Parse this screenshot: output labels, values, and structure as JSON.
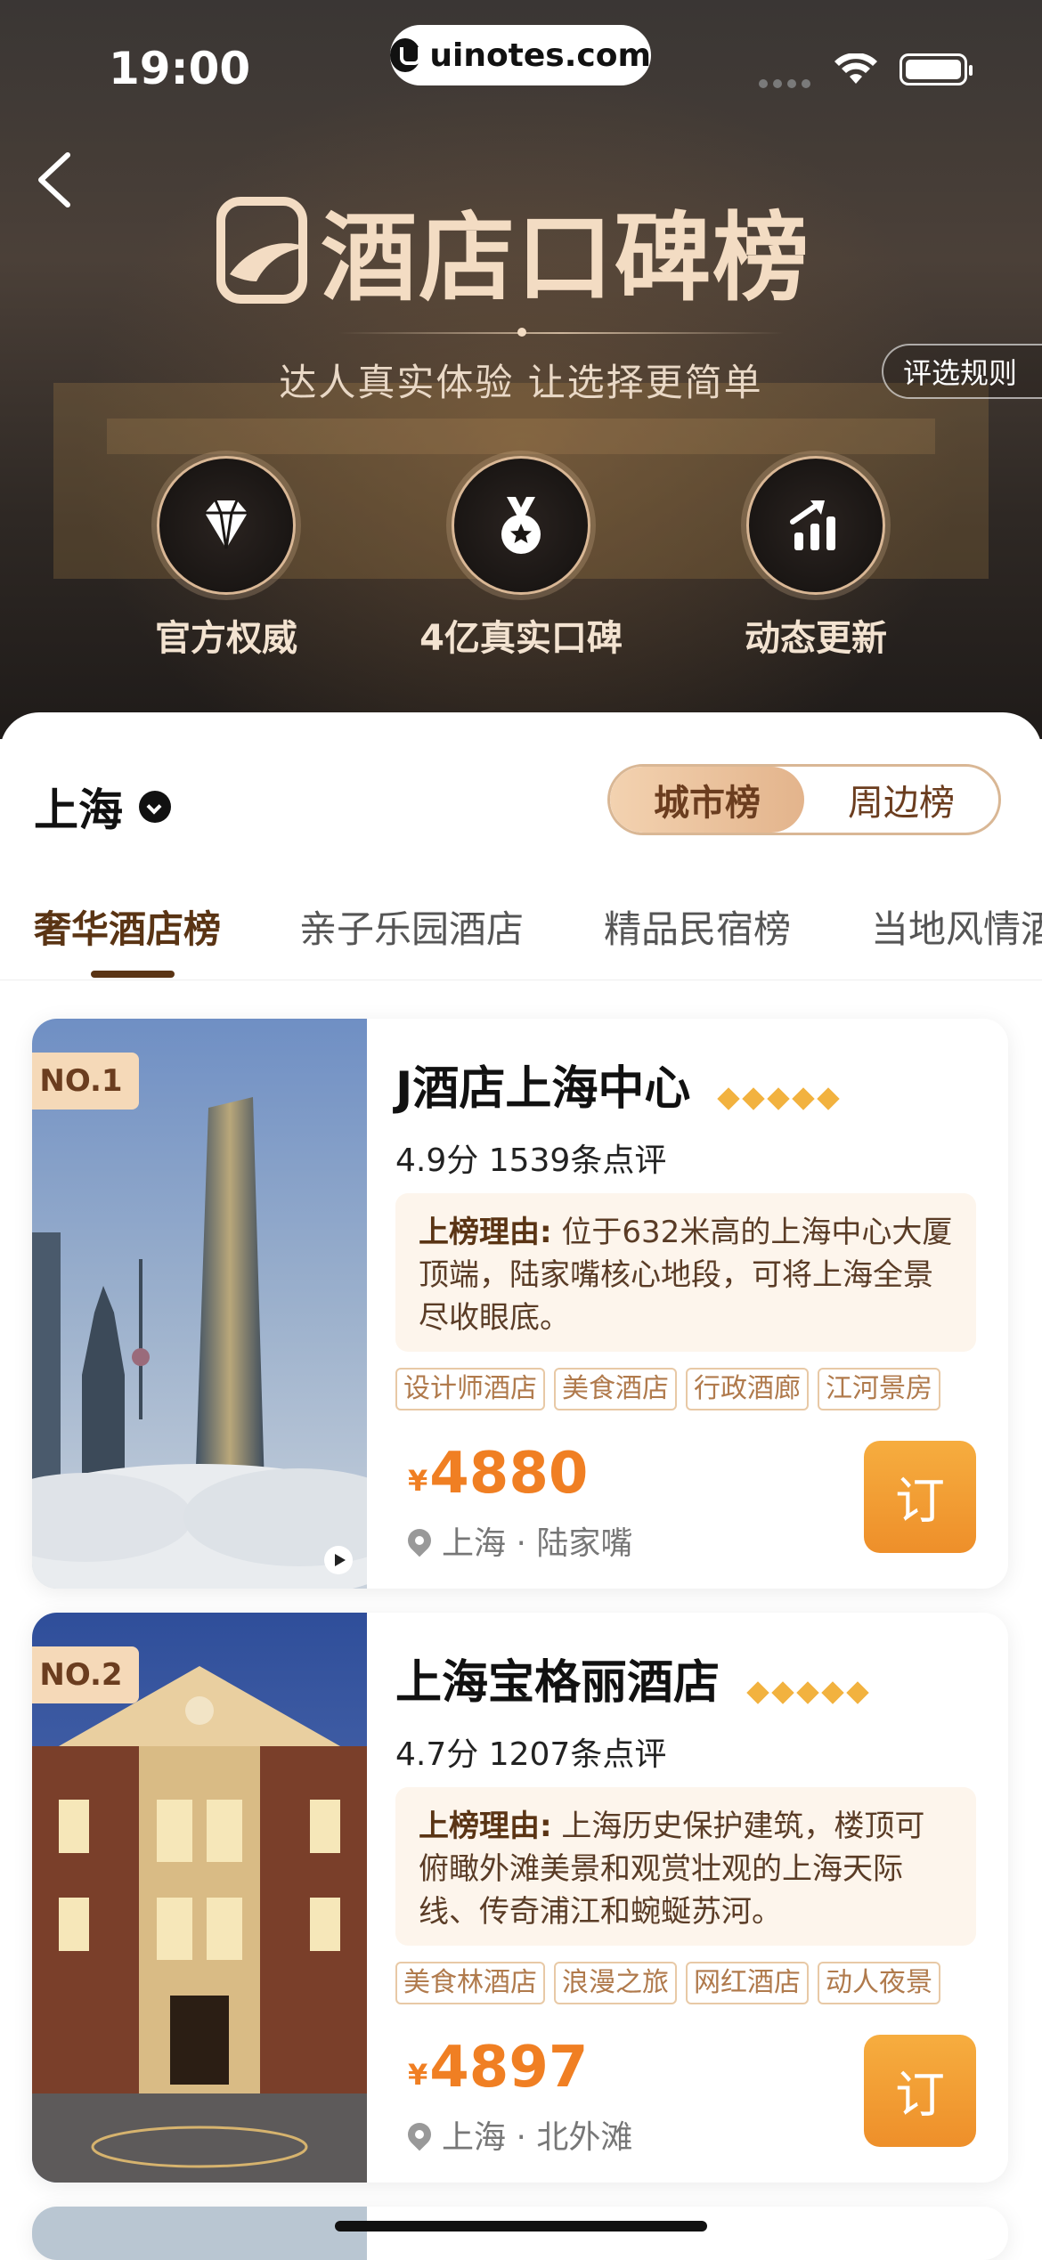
{
  "status_bar": {
    "time": "19:00",
    "url": "uinotes.com"
  },
  "header": {
    "title": "酒店口碑榜",
    "subtitle": "达人真实体验  让选择更简单",
    "rules_button": "评选规则",
    "badges": [
      {
        "label": "官方权威",
        "icon": "diamond-icon"
      },
      {
        "label": "4亿真实口碑",
        "icon": "medal-icon"
      },
      {
        "label": "动态更新",
        "icon": "rising-chart-icon"
      }
    ]
  },
  "city": {
    "name": "上海"
  },
  "scope_switch": {
    "options": [
      "城市榜",
      "周边榜"
    ],
    "selected": "城市榜"
  },
  "tabs": [
    {
      "label": "奢华酒店榜",
      "active": true
    },
    {
      "label": "亲子乐园酒店",
      "active": false
    },
    {
      "label": "精品民宿榜",
      "active": false
    },
    {
      "label": "当地风情酒店",
      "active": false
    }
  ],
  "hotels": [
    {
      "rank": "NO.1",
      "name": "J酒店上海中心",
      "diamonds": 5,
      "score_text": "4.9分 1539条点评",
      "reason_label": "上榜理由:",
      "reason": "位于632米高的上海中心大厦顶端，陆家嘴核心地段，可将上海全景尽收眼底。",
      "tags": [
        "设计师酒店",
        "美食酒店",
        "行政酒廊",
        "江河景房"
      ],
      "currency": "¥",
      "price": "4880",
      "location": "上海 · 陆家嘴",
      "book": "订"
    },
    {
      "rank": "NO.2",
      "name": "上海宝格丽酒店",
      "diamonds": 5,
      "score_text": "4.7分 1207条点评",
      "reason_label": "上榜理由:",
      "reason": "上海历史保护建筑，楼顶可俯瞰外滩美景和观赏壮观的上海天际线、传奇浦江和蜿蜒苏河。",
      "tags": [
        "美食林酒店",
        "浪漫之旅",
        "网红酒店",
        "动人夜景"
      ],
      "currency": "¥",
      "price": "4897",
      "location": "上海 · 北外滩",
      "book": "订"
    }
  ],
  "colors": {
    "accent": "#f07f23",
    "brand_brown": "#5a3414",
    "gold": "#d9b795"
  }
}
